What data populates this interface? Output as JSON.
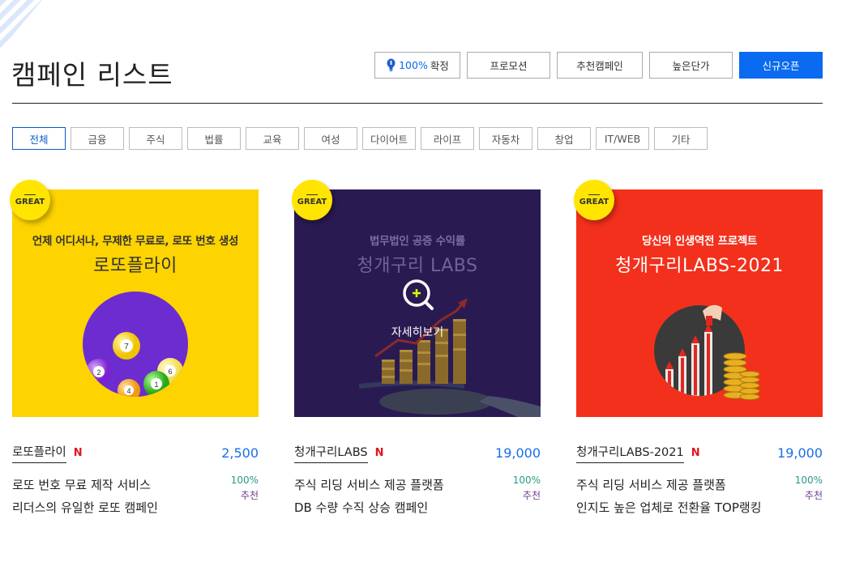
{
  "page": {
    "title": "캠페인 리스트"
  },
  "sort_buttons": [
    {
      "pct": "100%",
      "label": "확정",
      "icon": "lightbulb-icon"
    },
    {
      "label": "프로모션"
    },
    {
      "label": "추천캠페인"
    },
    {
      "label": "높은단가"
    },
    {
      "label": "신규오픈",
      "active": true
    }
  ],
  "categories": [
    "전체",
    "금융",
    "주식",
    "법률",
    "교육",
    "여성",
    "다이어트",
    "라이프",
    "자동차",
    "창업",
    "IT/WEB",
    "기타"
  ],
  "active_category": "전체",
  "colors": {
    "accent": "#0a6af0",
    "badge_new": "#e0161e",
    "great_badge": "#ffe500"
  },
  "cards": [
    {
      "badge": "GREAT",
      "thumb_sub": "언제 어디서나, 무제한 무료로, 로또 번호 생성",
      "thumb_main": "로또플라이",
      "name": "로또플라이",
      "new": "N",
      "price": "2,500",
      "desc1": "로또 번호 무료 제작 서비스",
      "desc2": "리더스의 유일한 로또 캠페인",
      "rate": "100%",
      "rec": "추천",
      "thumb_color": "#fdd300"
    },
    {
      "badge": "GREAT",
      "thumb_sub": "법무법인 공증 수익률",
      "thumb_main": "청개구리 LABS",
      "overlay": "자세히보기",
      "name": "청개구리LABS",
      "new": "N",
      "price": "19,000",
      "desc1": "주식 리딩 서비스 제공 플랫폼",
      "desc2": "DB 수량 수직 상승 캠페인",
      "rate": "100%",
      "rec": "추천",
      "thumb_color": "#2a1a52"
    },
    {
      "badge": "GREAT",
      "thumb_sub": "당신의 인생역전 프로젝트",
      "thumb_main": "청개구리LABS-2021",
      "name": "청개구리LABS-2021",
      "new": "N",
      "price": "19,000",
      "desc1": "주식 리딩 서비스 제공 플랫폼",
      "desc2": "인지도 높은 업체로 전환율 TOP랭킹",
      "rate": "100%",
      "rec": "추천",
      "thumb_color": "#f3301c"
    }
  ]
}
